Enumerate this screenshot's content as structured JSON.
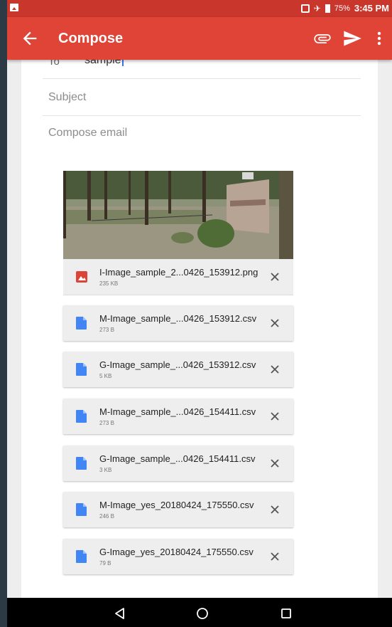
{
  "status_bar": {
    "battery": "75%",
    "time": "3:45 PM"
  },
  "appbar": {
    "title": "Compose",
    "icons": [
      "back-arrow-icon",
      "paperclip-icon",
      "send-icon",
      "more-vert-icon"
    ]
  },
  "compose": {
    "to_label": "To",
    "to_value": "sample",
    "subject_placeholder": "Subject",
    "body_placeholder": "Compose email"
  },
  "attachments": [
    {
      "name": "I-Image_sample_2...0426_153912.png",
      "size": "235 KB",
      "type": "image"
    },
    {
      "name": "M-Image_sample_...0426_153912.csv",
      "size": "273 B",
      "type": "file"
    },
    {
      "name": "G-Image_sample_...0426_153912.csv",
      "size": "5 KB",
      "type": "file"
    },
    {
      "name": "M-Image_sample_...0426_154411.csv",
      "size": "273 B",
      "type": "file"
    },
    {
      "name": "G-Image_sample_...0426_154411.csv",
      "size": "3 KB",
      "type": "file"
    },
    {
      "name": "M-Image_yes_20180424_175550.csv",
      "size": "246 B",
      "type": "file"
    },
    {
      "name": "G-Image_yes_20180424_175550.csv",
      "size": "79 B",
      "type": "file"
    }
  ],
  "colors": {
    "appbar": "#df4437",
    "status_bar": "#c9362c",
    "file_icon": "#4285f4",
    "image_icon": "#db4437"
  }
}
